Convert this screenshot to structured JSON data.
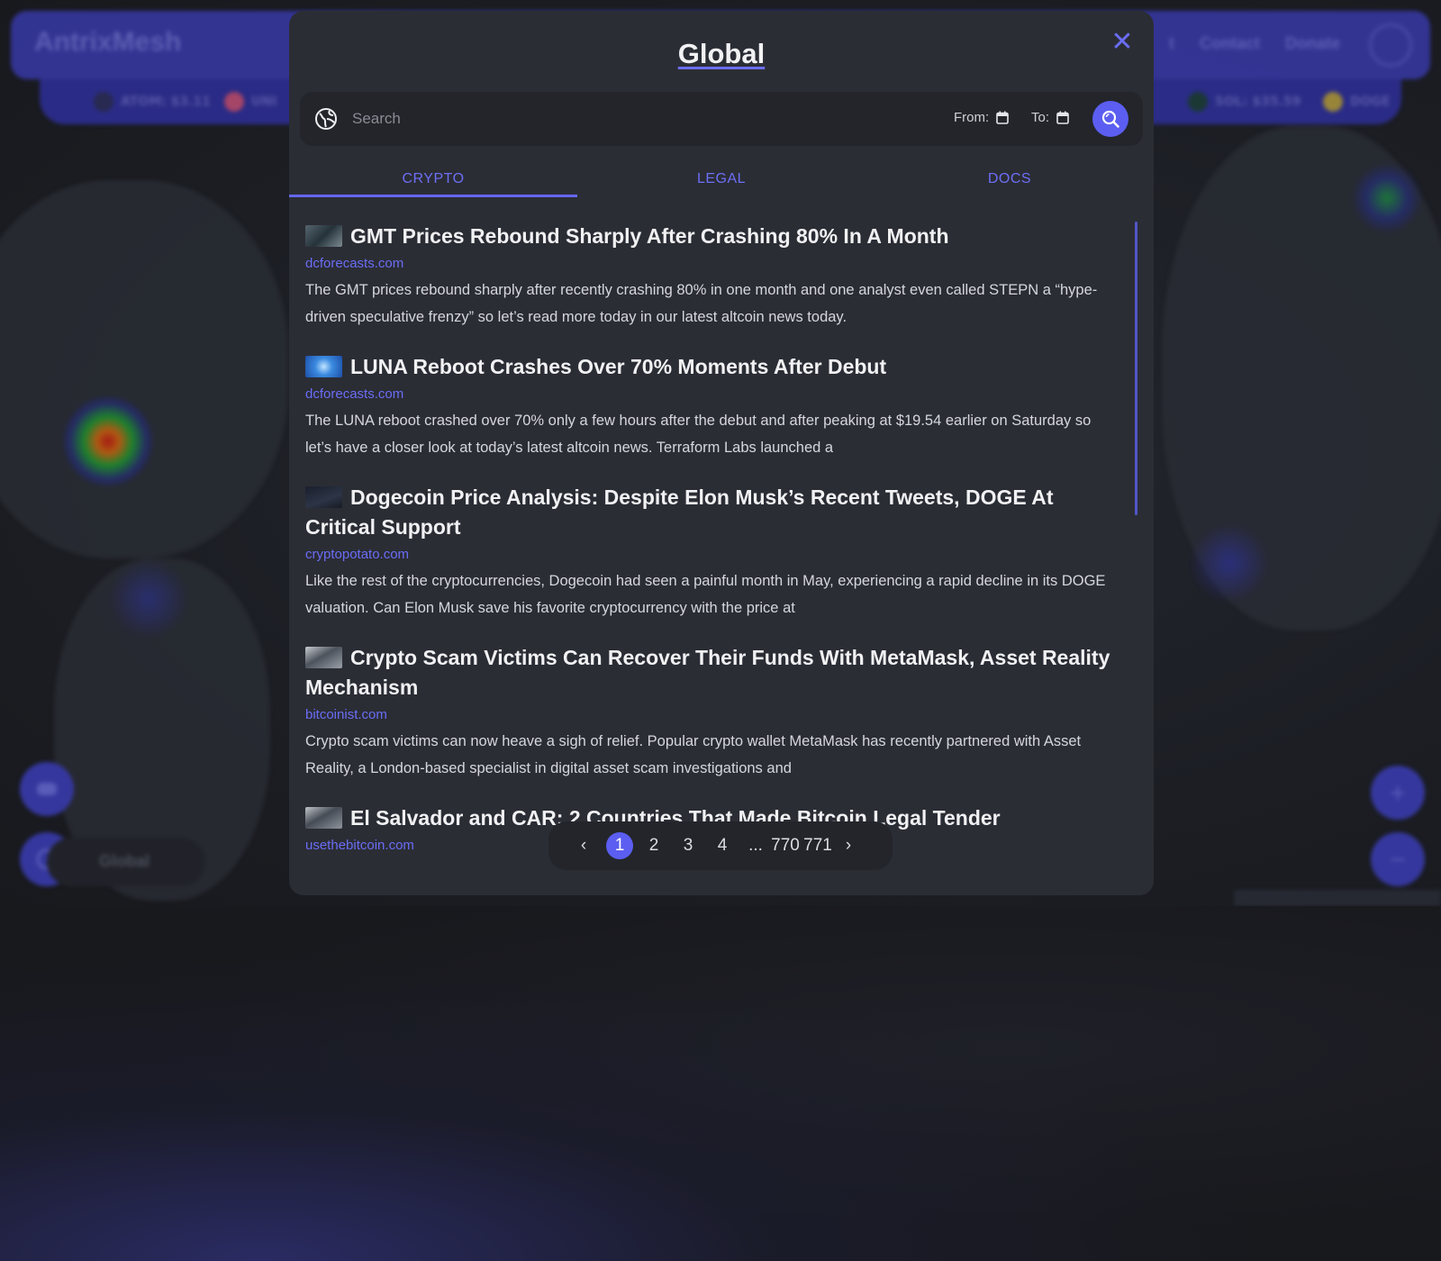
{
  "background": {
    "brand": "AntrixMesh",
    "nav_links": [
      "t",
      "Contact",
      "Donate"
    ],
    "ticker": [
      {
        "label": "ATOM: $3.11",
        "color": "#2c2f5e"
      },
      {
        "label": "UNI",
        "color": "#c8507a"
      },
      {
        "label": "SOL: $35.59",
        "color": "#1d3f3a"
      },
      {
        "label": "DOGE",
        "color": "#b8a040"
      }
    ],
    "global_pill": "Global"
  },
  "modal": {
    "title": "Global",
    "close_icon": "close-icon",
    "search": {
      "placeholder": "Search",
      "value": "",
      "from_label": "From:",
      "to_label": "To:"
    },
    "tabs": [
      {
        "label": "CRYPTO",
        "active": true
      },
      {
        "label": "LEGAL",
        "active": false
      },
      {
        "label": "DOCS",
        "active": false
      }
    ],
    "articles": [
      {
        "title": "GMT Prices Rebound Sharply After Crashing 80% In A Month",
        "source": "dcforecasts.com",
        "summary": "The GMT prices rebound sharply after recently crashing 80% in one month and one analyst even called STEPN a “hype-driven speculative frenzy” so let’s read more today in our latest altcoin news today.",
        "thumb_color": "#3a4a50"
      },
      {
        "title": "LUNA Reboot Crashes Over 70% Moments After Debut",
        "source": "dcforecasts.com",
        "summary": "The LUNA reboot crashed over 70% only a few hours after the debut and after peaking at $19.54 earlier on Saturday so let’s have a closer look at today’s latest altcoin news. Terraform Labs launched a",
        "thumb_color": "#2f6fd0"
      },
      {
        "title": "Dogecoin Price Analysis: Despite Elon Musk’s Recent Tweets, DOGE At Critical Support",
        "source": "cryptopotato.com",
        "summary": "Like the rest of the cryptocurrencies, Dogecoin had seen a painful month in May, experiencing a rapid decline in its DOGE valuation. Can Elon Musk save his favorite cryptocurrency with the price at",
        "thumb_color": "#1e2432"
      },
      {
        "title": "Crypto Scam Victims Can Recover Their Funds With MetaMask, Asset Reality Mechanism",
        "source": "bitcoinist.com",
        "summary": "Crypto scam victims can now heave a sigh of relief. Popular crypto wallet MetaMask has recently partnered with Asset Reality, a London-based specialist in digital asset scam investigations and",
        "thumb_color": "#6a6f78"
      },
      {
        "title": "El Salvador and CAR: 2 Countries That Made Bitcoin Legal Tender",
        "source": "usethebitcoin.com",
        "summary": "",
        "thumb_color": "#5a6068"
      }
    ],
    "pagination": {
      "prev": "‹",
      "pages": [
        "1",
        "2",
        "3",
        "4",
        "...",
        "770",
        "771"
      ],
      "current": "1",
      "next": "›"
    }
  },
  "colors": {
    "accent": "#5b5ef0",
    "modal_bg": "#2b2d35",
    "text": "#f1f1f3"
  }
}
